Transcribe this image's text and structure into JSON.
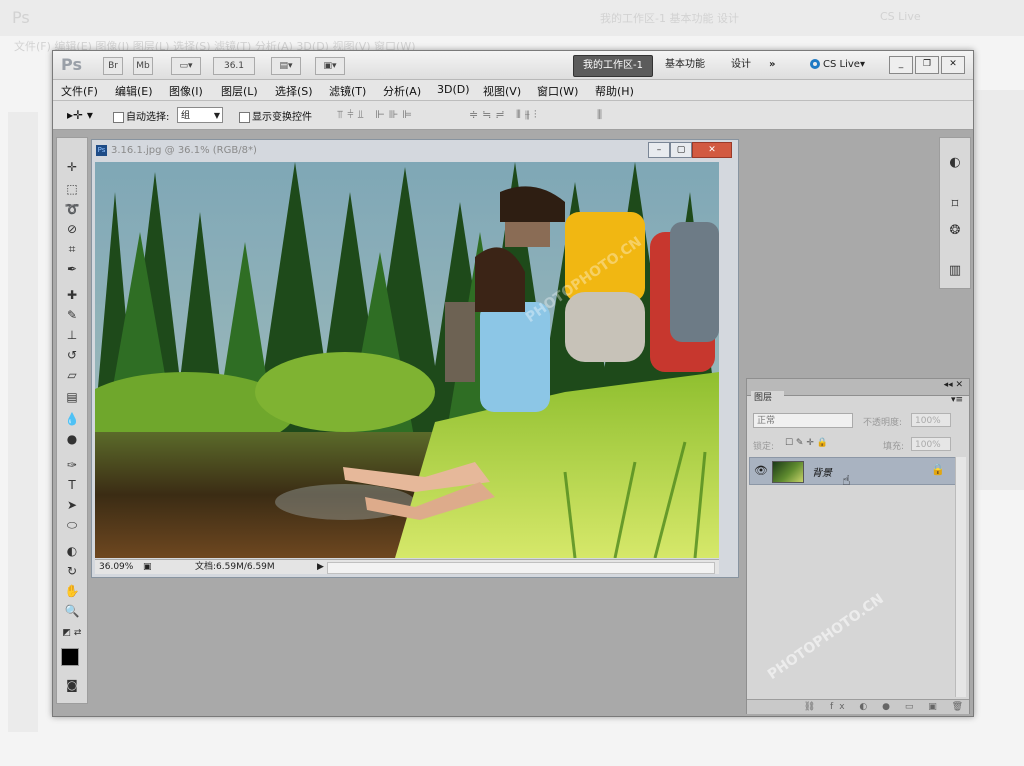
{
  "app": {
    "logo": "Ps",
    "buttons": [
      "Br",
      "Mb"
    ],
    "zoom_select": "36.1",
    "workspaces": {
      "active": "我的工作区-1",
      "items": [
        "基本功能",
        "设计",
        "»"
      ]
    },
    "cslive": "CS Live"
  },
  "ghost": {
    "logo": "Ps",
    "menu": "文件(F)   编辑(E)   图像(I)   图层(L)   选择(S)   滤镜(T)   分析(A)   3D(D)   视图(V)   窗口(W)",
    "ws": "我的工作区-1   基本功能   设计",
    "cslive": "CS Live"
  },
  "menubar": [
    "文件(F)",
    "编辑(E)",
    "图像(I)",
    "图层(L)",
    "选择(S)",
    "滤镜(T)",
    "分析(A)",
    "3D(D)",
    "视图(V)",
    "窗口(W)",
    "帮助(H)"
  ],
  "options": {
    "auto_select": "自动选择:",
    "group_value": "组",
    "show_transform": "显示变换控件"
  },
  "document": {
    "title": "3.16.1.jpg @ 36.1% (RGB/8*)",
    "zoom": "36.09%",
    "doc_info": "文档:6.59M/6.59M"
  },
  "layers_panel": {
    "tab": "图层",
    "blend_mode": "正常",
    "opacity_label": "不透明度:",
    "opacity_value": "100%",
    "lock_label": "锁定:",
    "fill_label": "填充:",
    "fill_value": "100%",
    "layer_name": "背景"
  },
  "watermark": "PHOTOPHOTO.CN",
  "colors": {
    "accent": "#5b5b5b",
    "selection": "#a9b3c1",
    "cslive_blue": "#1f7ac4"
  }
}
